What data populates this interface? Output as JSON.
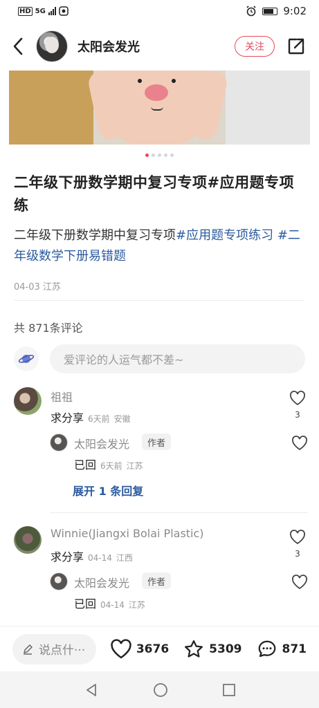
{
  "status_bar": {
    "network_hd": "HD",
    "network_5g": "5G",
    "time": "9:02"
  },
  "header": {
    "author_name": "太阳会发光",
    "follow_label": "关注"
  },
  "carousel": {
    "total": 5,
    "active_index": 0
  },
  "post": {
    "title": "二年级下册数学期中复习专项#应用题专项练",
    "body_plain": "二年级下册数学期中复习专项",
    "tag1": "#应用题专项练习",
    "tag2": "#二年级数学下册易错题",
    "meta": "04-03 江苏"
  },
  "comments_section": {
    "count_label": "共 871条评论",
    "input_placeholder": "爱评论的人运气都不差~",
    "comments": [
      {
        "user": "祖祖",
        "text": "求分享",
        "time": "6天前",
        "location": "安徽",
        "likes": "3",
        "reply": {
          "user": "太阳会发光",
          "badge": "作者",
          "text": "已回",
          "time": "6天前",
          "location": "江苏"
        },
        "expand_label": "展开 1 条回复"
      },
      {
        "user": "Winnie(Jiangxi Bolai Plastic)",
        "text": "求分享",
        "time": "04-14",
        "location": "江西",
        "likes": "3",
        "reply": {
          "user": "太阳会发光",
          "badge": "作者",
          "text": "已回",
          "time": "04-14",
          "location": "江苏"
        }
      }
    ]
  },
  "bottom_bar": {
    "say_placeholder": "说点什···",
    "likes": "3676",
    "favorites": "5309",
    "comments": "871"
  },
  "icons": {
    "back": "back-arrow-icon",
    "share": "share-icon",
    "heart": "heart-icon",
    "star": "star-icon",
    "comment": "comment-bubble-icon"
  },
  "colors": {
    "accent": "#e8465b",
    "tag_blue": "#2b5a9e"
  }
}
